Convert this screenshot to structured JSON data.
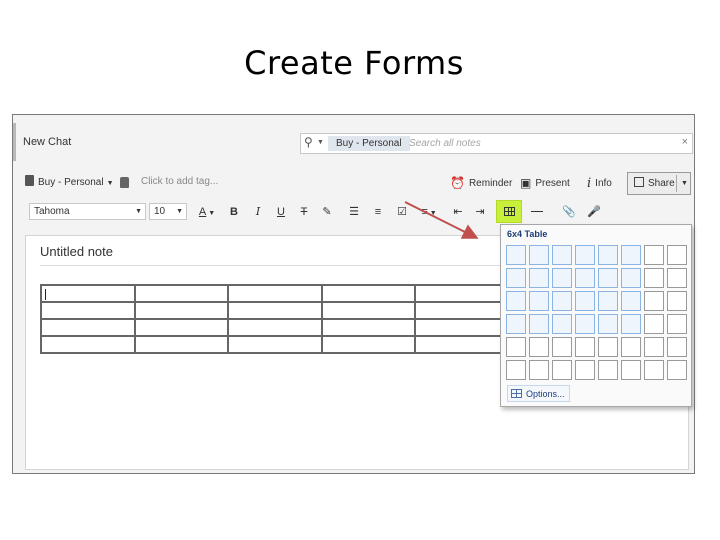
{
  "slide": {
    "title": "Create Forms"
  },
  "title_bar": {
    "tab_label": "New Chat",
    "search": {
      "scope_label": "Buy - Personal",
      "placeholder": "Search all notes",
      "clear": "×"
    }
  },
  "tag_bar": {
    "notebook": "Buy - Personal",
    "tag_placeholder": "Click to add tag...",
    "actions": {
      "reminder": "Reminder",
      "present": "Present",
      "info": "Info",
      "share": "Share"
    }
  },
  "format_bar": {
    "font": "Tahoma",
    "size": "10",
    "bold": "B",
    "italic": "I",
    "underline": "U",
    "strike": "T",
    "font_color": "A"
  },
  "note": {
    "title": "Untitled note",
    "table": {
      "rows": 4,
      "cols": 5
    }
  },
  "table_picker": {
    "label": "6x4 Table",
    "grid_rows": 6,
    "grid_cols": 8,
    "selected_rows": 4,
    "selected_cols": 6,
    "options_label": "Options..."
  },
  "colors": {
    "highlight": "#c8f03a",
    "arrow": "#c0504d",
    "selected_cell": "#89b4e4",
    "picker_text": "#1e3e7a"
  }
}
